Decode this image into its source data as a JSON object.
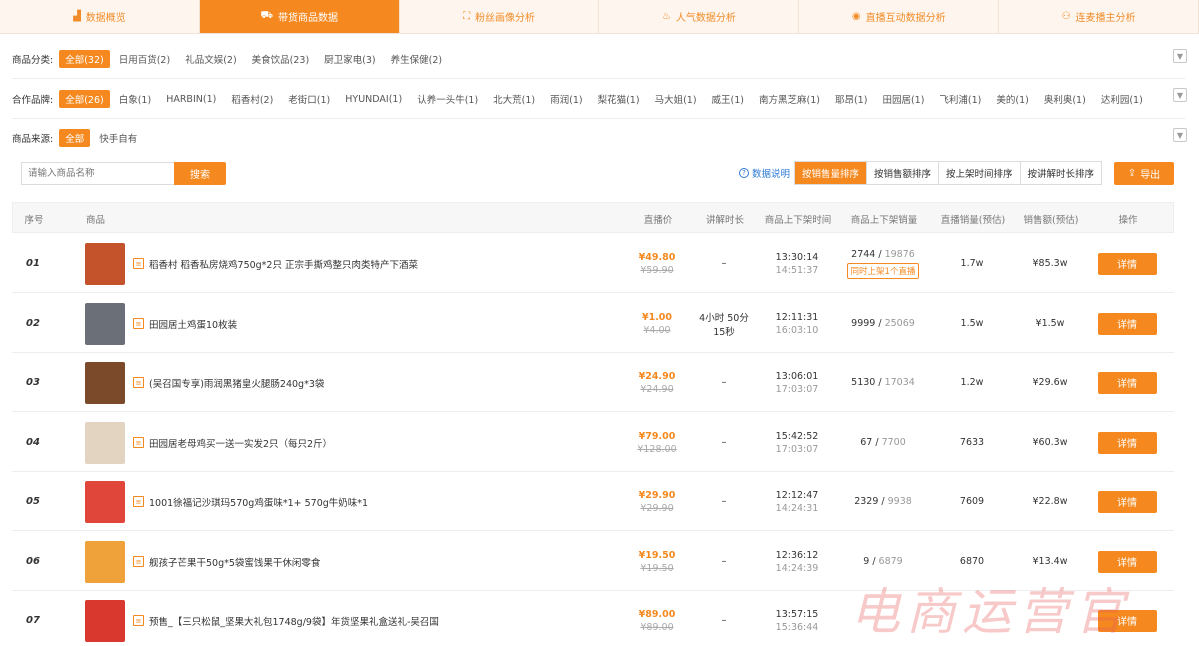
{
  "tabs": [
    {
      "label": "数据概览",
      "icon": "bar-chart-icon",
      "glyph": "▟"
    },
    {
      "label": "带货商品数据",
      "icon": "bag-icon",
      "glyph": "⛟"
    },
    {
      "label": "粉丝画像分析",
      "icon": "portrait-icon",
      "glyph": "⛶"
    },
    {
      "label": "人气数据分析",
      "icon": "flame-icon",
      "glyph": "♨"
    },
    {
      "label": "直播互动数据分析",
      "icon": "chat-icon",
      "glyph": "◉"
    },
    {
      "label": "连麦播主分析",
      "icon": "users-icon",
      "glyph": "⚇"
    }
  ],
  "filters": {
    "category": {
      "label": "商品分类:",
      "options": [
        "全部(32)",
        "日用百货(2)",
        "礼品文娱(2)",
        "美食饮品(23)",
        "厨卫家电(3)",
        "养生保健(2)"
      ]
    },
    "brand": {
      "label": "合作品牌:",
      "options": [
        "全部(26)",
        "白象(1)",
        "HARBIN(1)",
        "稻香村(2)",
        "老街口(1)",
        "HYUNDAI(1)",
        "认养一头牛(1)",
        "北大荒(1)",
        "雨润(1)",
        "梨花猫(1)",
        "马大姐(1)",
        "威王(1)",
        "南方黑芝麻(1)",
        "耶昂(1)",
        "田园居(1)",
        "飞利浦(1)",
        "美的(1)",
        "奥利奥(1)",
        "达利园(1)"
      ]
    },
    "source": {
      "label": "商品来源:",
      "options": [
        "全部",
        "快手自有"
      ]
    }
  },
  "search": {
    "placeholder": "请输入商品名称",
    "button": "搜索"
  },
  "data_desc": "数据说明",
  "sorts": [
    "按销售量排序",
    "按销售额排序",
    "按上架时间排序",
    "按讲解时长排序"
  ],
  "export_label": "导出",
  "columns": [
    "序号",
    "商品",
    "直播价",
    "讲解时长",
    "商品上下架时间",
    "商品上下架销量",
    "直播销量(预估)",
    "销售额(预估)",
    "操作"
  ],
  "rows": [
    {
      "idx": "01",
      "name": "稻香村 稻香私房烧鸡750g*2只 正宗手撕鸡整只肉类特产下酒菜",
      "price": "¥49.80",
      "orig": "¥59.90",
      "duration": "–",
      "t_on": "13:30:14",
      "t_off": "14:51:37",
      "sold": "2744",
      "total": "19876",
      "tag": "同时上架1个直播",
      "live_sales": "1.7w",
      "revenue": "¥85.3w",
      "action": "详情"
    },
    {
      "idx": "02",
      "name": "田园居土鸡蛋10枚装",
      "price": "¥1.00",
      "orig": "¥4.00",
      "duration": "4小时 50分 15秒",
      "t_on": "12:11:31",
      "t_off": "16:03:10",
      "sold": "9999",
      "total": "25069",
      "tag": "",
      "live_sales": "1.5w",
      "revenue": "¥1.5w",
      "action": "详情"
    },
    {
      "idx": "03",
      "name": "(吴召国专享)雨润黑猪皇火腿肠240g*3袋",
      "price": "¥24.90",
      "orig": "¥24.90",
      "duration": "–",
      "t_on": "13:06:01",
      "t_off": "17:03:07",
      "sold": "5130",
      "total": "17034",
      "tag": "",
      "live_sales": "1.2w",
      "revenue": "¥29.6w",
      "action": "详情"
    },
    {
      "idx": "04",
      "name": "田园居老母鸡买一送一实发2只（每只2斤）",
      "price": "¥79.00",
      "orig": "¥128.00",
      "duration": "–",
      "t_on": "15:42:52",
      "t_off": "17:03:07",
      "sold": "67",
      "total": "7700",
      "tag": "",
      "live_sales": "7633",
      "revenue": "¥60.3w",
      "action": "详情"
    },
    {
      "idx": "05",
      "name": "1001徐福记沙琪玛570g鸡蛋味*1+ 570g牛奶味*1",
      "price": "¥29.90",
      "orig": "¥29.90",
      "duration": "–",
      "t_on": "12:12:47",
      "t_off": "14:24:31",
      "sold": "2329",
      "total": "9938",
      "tag": "",
      "live_sales": "7609",
      "revenue": "¥22.8w",
      "action": "详情"
    },
    {
      "idx": "06",
      "name": "舰孩子芒果干50g*5袋蜜饯果干休闲零食",
      "price": "¥19.50",
      "orig": "¥19.50",
      "duration": "–",
      "t_on": "12:36:12",
      "t_off": "14:24:39",
      "sold": "9",
      "total": "6879",
      "tag": "",
      "live_sales": "6870",
      "revenue": "¥13.4w",
      "action": "详情"
    },
    {
      "idx": "07",
      "name": "预售_【三只松鼠_坚果大礼包1748g/9袋】年货坚果礼盒送礼-吴召国",
      "price": "¥89.00",
      "orig": "¥89.00",
      "duration": "–",
      "t_on": "13:57:15",
      "t_off": "15:36:44",
      "sold": "",
      "total": "",
      "tag": "",
      "live_sales": "",
      "revenue": "",
      "action": "详情"
    }
  ],
  "thumb_colors": [
    "#c4532c",
    "#6b6f78",
    "#7a4a2a",
    "#e2d4c0",
    "#e0473a",
    "#f0a23a",
    "#d8382e"
  ],
  "watermark": "电商运营官",
  "colors": {
    "accent": "#f5891f",
    "link": "#2f7ad6",
    "tab_bg": "#fef6ee"
  }
}
